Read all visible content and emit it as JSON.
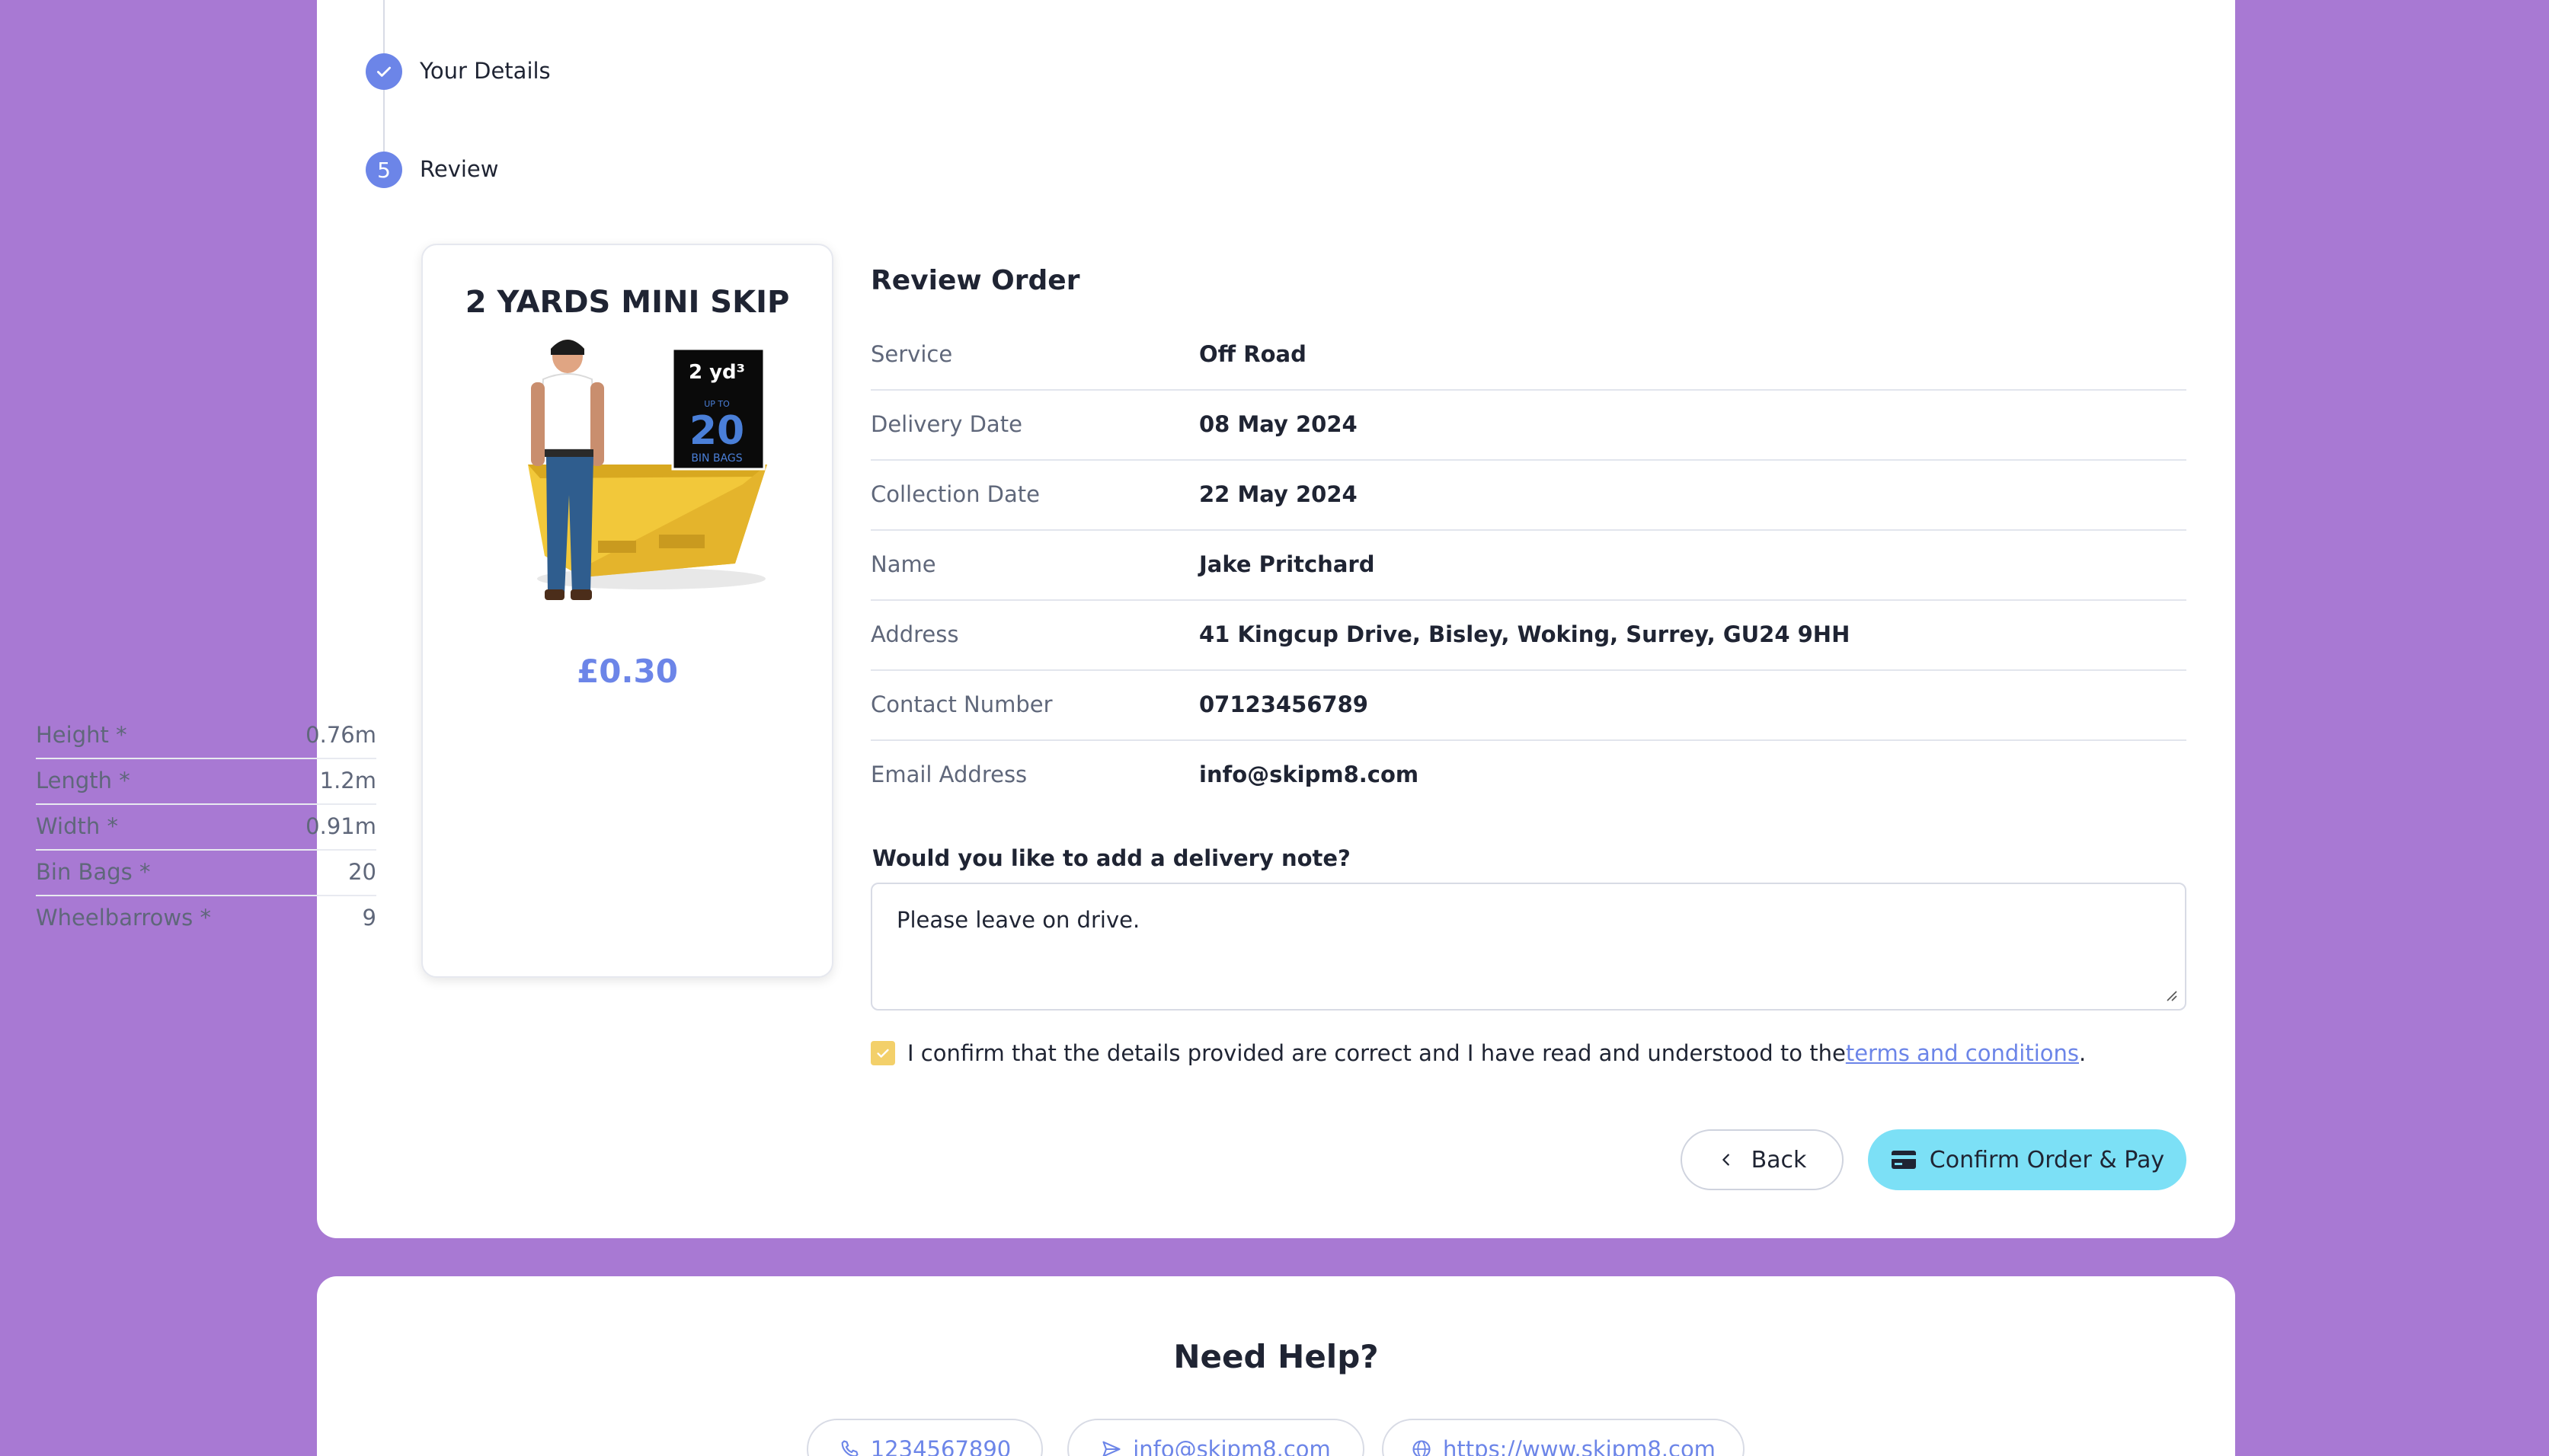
{
  "stepper": {
    "steps": [
      {
        "label": "Your Details",
        "state": "complete",
        "icon": "check-icon"
      },
      {
        "label": "Review",
        "state": "current",
        "number": "5"
      }
    ]
  },
  "skip": {
    "title": "2 YARDS MINI SKIP",
    "badge": {
      "size": "2 yd³",
      "upto": "UP TO",
      "bags": "20",
      "bags_label": "BIN BAGS"
    },
    "price": "£0.30",
    "specs": [
      {
        "label": "Height *",
        "value": "0.76m"
      },
      {
        "label": "Length *",
        "value": "1.2m"
      },
      {
        "label": "Width *",
        "value": "0.91m"
      },
      {
        "label": "Bin Bags *",
        "value": "20"
      },
      {
        "label": "Wheelbarrows *",
        "value": "9"
      }
    ]
  },
  "review": {
    "title": "Review Order",
    "rows": [
      {
        "label": "Service",
        "value": "Off Road"
      },
      {
        "label": "Delivery Date",
        "value": "08 May 2024"
      },
      {
        "label": "Collection Date",
        "value": "22 May 2024"
      },
      {
        "label": "Name",
        "value": "Jake Pritchard"
      },
      {
        "label": "Address",
        "value": "41 Kingcup Drive, Bisley, Woking, Surrey, GU24 9HH"
      },
      {
        "label": "Contact Number",
        "value": "07123456789"
      },
      {
        "label": "Email Address",
        "value": "info@skipm8.com"
      }
    ],
    "note_label": "Would you like to add a delivery note?",
    "note_value": "Please leave on drive.",
    "confirm_text": "I confirm that the details provided are correct and I have read and understood to the ",
    "terms_link": "terms and conditions",
    "confirm_end": ".",
    "confirm_checked": true
  },
  "actions": {
    "back_label": "Back",
    "pay_label": "Confirm Order & Pay"
  },
  "help": {
    "title": "Need Help?",
    "phone": "1234567890",
    "email": "info@skipm8.com",
    "website": "https://www.skipm8.com"
  },
  "colors": {
    "background": "#a879d3",
    "accent": "#6c85e8",
    "pay_button": "#7ce0f6",
    "checkbox": "#f3d06a"
  }
}
